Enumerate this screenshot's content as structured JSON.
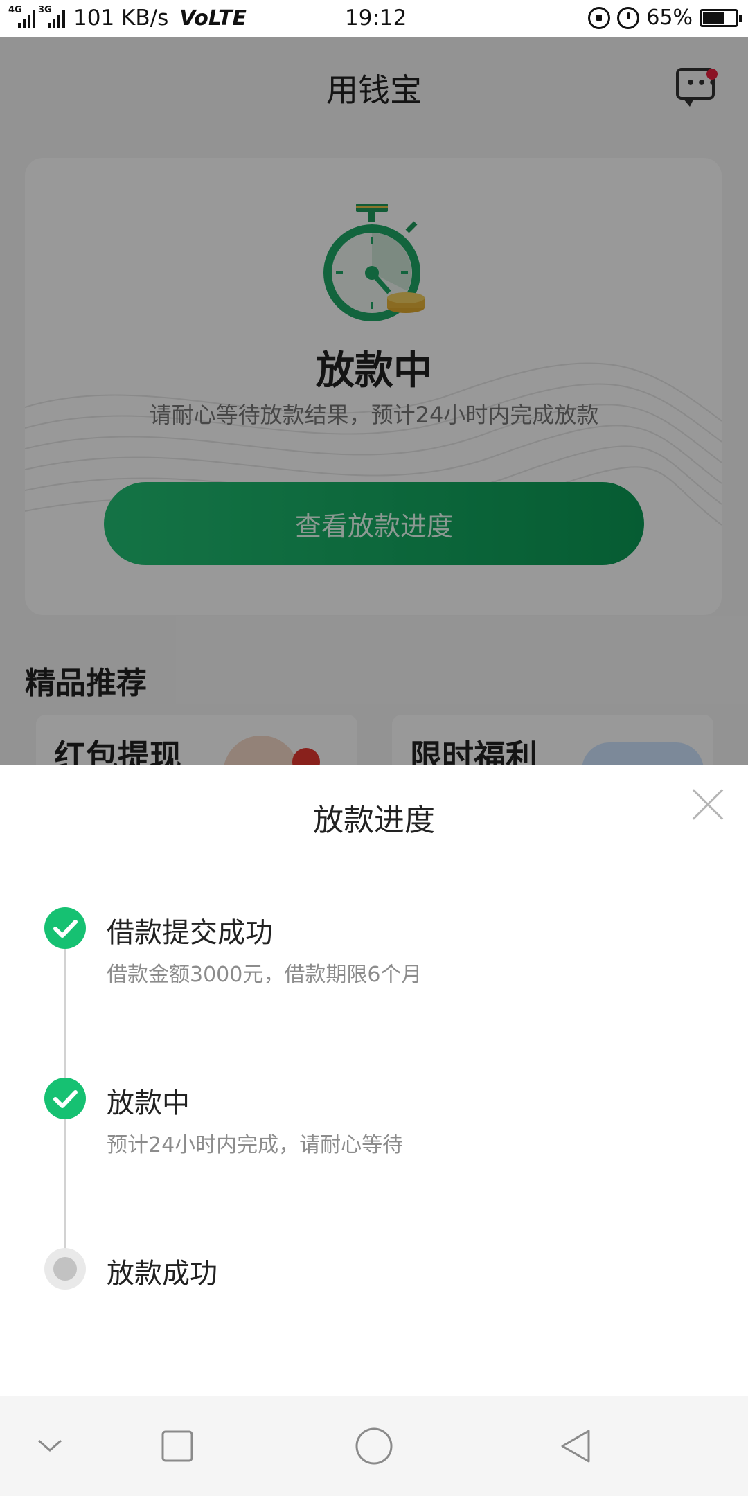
{
  "status_bar": {
    "network_1": "4G",
    "network_2": "3G",
    "speed": "101 KB/s",
    "volte": "VoLTE",
    "time": "19:12",
    "battery": "65%",
    "battery_level": 0.65
  },
  "background_page": {
    "title": "用钱宝",
    "status_title": "放款中",
    "status_subtitle": "请耐心等待放款结果，预计24小时内完成放款",
    "progress_button": "查看放款进度",
    "section_title": "精品推荐",
    "cards": [
      {
        "label": "红包提现"
      },
      {
        "label": "限时福利"
      }
    ]
  },
  "sheet": {
    "title": "放款进度",
    "steps": [
      {
        "title": "借款提交成功",
        "desc": "借款金额3000元，借款期限6个月",
        "state": "done"
      },
      {
        "title": "放款中",
        "desc": "预计24小时内完成，请耐心等待",
        "state": "done"
      },
      {
        "title": "放款成功",
        "desc": "",
        "state": "pending"
      }
    ]
  },
  "colors": {
    "accent_green": "#16c172",
    "button_green": "#0b9a55",
    "badge_red": "#e8203e"
  },
  "icons": {
    "close": "close-icon",
    "check": "check-icon",
    "message": "chat-icon",
    "nav_down": "chevron-down-icon",
    "nav_recent": "square-icon",
    "nav_home": "circle-icon",
    "nav_back": "triangle-back-icon"
  }
}
